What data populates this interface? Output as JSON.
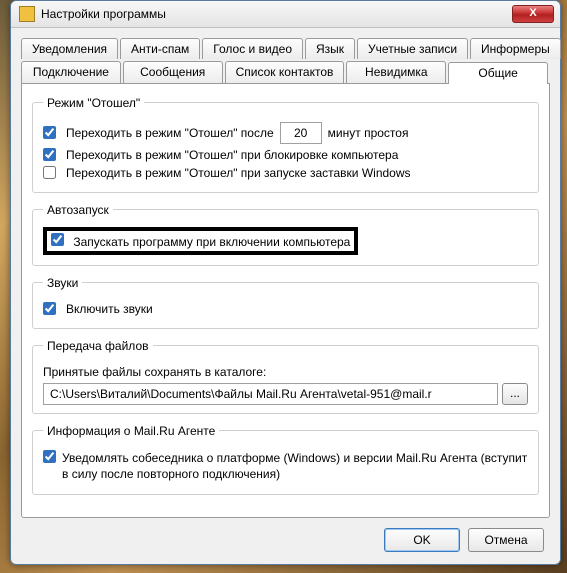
{
  "window": {
    "title": "Настройки программы",
    "close_glyph": "X"
  },
  "tabs": {
    "row1": [
      {
        "label": "Уведомления"
      },
      {
        "label": "Анти-спам"
      },
      {
        "label": "Голос и видео"
      },
      {
        "label": "Язык"
      },
      {
        "label": "Учетные записи"
      },
      {
        "label": "Информеры"
      }
    ],
    "row2": [
      {
        "label": "Подключение"
      },
      {
        "label": "Сообщения"
      },
      {
        "label": "Список контактов"
      },
      {
        "label": "Невидимка"
      },
      {
        "label": "Общие"
      }
    ]
  },
  "away": {
    "legend": "Режим \"Отошел\"",
    "after_label": "Переходить в режим \"Отошел\" после",
    "minutes_value": "20",
    "minutes_suffix": "минут простоя",
    "on_lock_label": "Переходить в режим \"Отошел\" при блокировке компьютера",
    "on_saver_label": "Переходить в режим \"Отошел\" при запуске заставки Windows"
  },
  "autorun": {
    "legend": "Автозапуск",
    "label": "Запускать программу при включении компьютера"
  },
  "sounds": {
    "legend": "Звуки",
    "label": "Включить звуки"
  },
  "files": {
    "legend": "Передача файлов",
    "save_label": "Принятые файлы сохранять в каталоге:",
    "path": "C:\\Users\\Виталий\\Documents\\Файлы Mail.Ru Агента\\vetal-951@mail.r",
    "browse_glyph": "..."
  },
  "info": {
    "legend": "Информация о Mail.Ru Агенте",
    "notify_label": "Уведомлять собеседника о платформе (Windows) и версии Mail.Ru Агента (вступит в силу после повторного подключения)"
  },
  "buttons": {
    "ok": "OK",
    "cancel": "Отмена"
  }
}
